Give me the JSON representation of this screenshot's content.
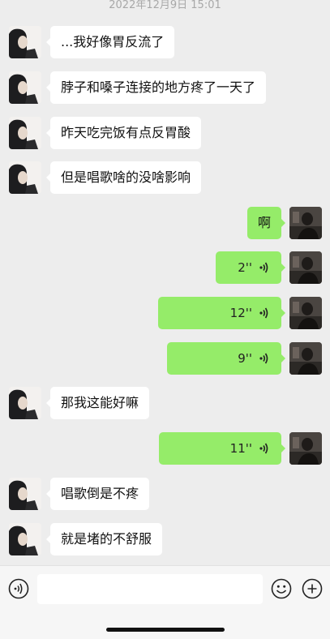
{
  "chat": {
    "timestamp": "2022年12月9日 15:01",
    "messages": [
      {
        "from": "them",
        "type": "text",
        "text": "...我好像胃反流了"
      },
      {
        "from": "them",
        "type": "text",
        "text": "脖子和嗓子连接的地方疼了一天了"
      },
      {
        "from": "them",
        "type": "text",
        "text": "昨天吃完饭有点反胃酸"
      },
      {
        "from": "them",
        "type": "text",
        "text": "但是唱歌啥的没啥影响"
      },
      {
        "from": "me",
        "type": "text",
        "text": "啊"
      },
      {
        "from": "me",
        "type": "voice",
        "duration": "2''"
      },
      {
        "from": "me",
        "type": "voice",
        "duration": "12''"
      },
      {
        "from": "me",
        "type": "voice",
        "duration": "9''"
      },
      {
        "from": "them",
        "type": "text",
        "text": "那我这能好嘛"
      },
      {
        "from": "me",
        "type": "voice",
        "duration": "11''"
      },
      {
        "from": "them",
        "type": "text",
        "text": "唱歌倒是不疼"
      },
      {
        "from": "them",
        "type": "text",
        "text": "就是堵的不舒服"
      }
    ]
  },
  "input": {
    "value": "",
    "placeholder": ""
  },
  "colors": {
    "background": "#ededed",
    "my_bubble": "#95ec69",
    "their_bubble": "#ffffff"
  },
  "icons": {
    "voice": "voice-input-icon",
    "emoji": "emoji-icon",
    "plus": "plus-icon",
    "wave": "voice-wave-icon"
  }
}
